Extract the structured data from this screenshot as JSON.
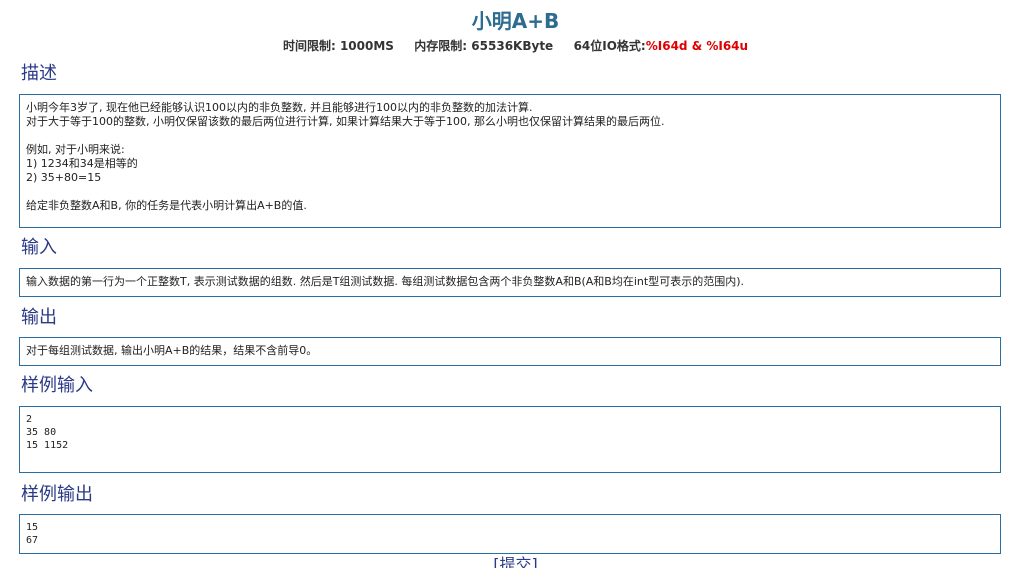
{
  "problem": {
    "title": "小明A+B",
    "time_limit_label": "时间限制:",
    "time_limit_value": "1000MS",
    "memory_limit_label": "内存限制:",
    "memory_limit_value": "65536KByte",
    "io_format_label": "64位IO格式:",
    "io_format_value": "%I64d & %I64u"
  },
  "sections": {
    "description": {
      "heading": "描述",
      "text": "小明今年3岁了, 现在他已经能够认识100以内的非负整数, 并且能够进行100以内的非负整数的加法计算.\n对于大于等于100的整数, 小明仅保留该数的最后两位进行计算, 如果计算结果大于等于100, 那么小明也仅保留计算结果的最后两位.\n\n例如, 对于小明来说:\n1) 1234和34是相等的\n2) 35+80=15\n\n给定非负整数A和B, 你的任务是代表小明计算出A+B的值."
    },
    "input": {
      "heading": "输入",
      "text": "输入数据的第一行为一个正整数T, 表示测试数据的组数. 然后是T组测试数据. 每组测试数据包含两个非负整数A和B(A和B均在int型可表示的范围内)."
    },
    "output": {
      "heading": "输出",
      "text": "对于每组测试数据, 输出小明A+B的结果，结果不含前导0。"
    },
    "sample_input": {
      "heading": "样例输入",
      "text": "2\n35 80\n15 1152"
    },
    "sample_output": {
      "heading": "样例输出",
      "text": "15\n67"
    }
  },
  "actions": {
    "submit_label": "[提交]"
  }
}
